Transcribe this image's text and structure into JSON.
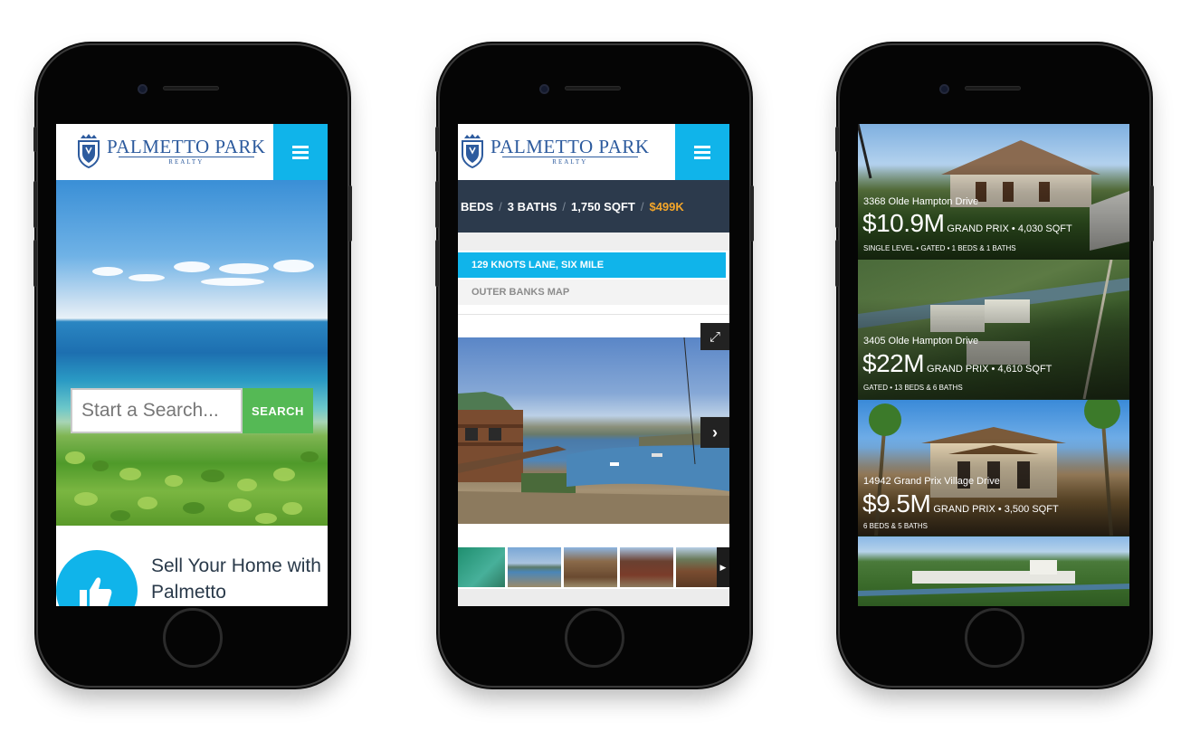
{
  "brand": {
    "name": "PALMETTO PARK",
    "sub": "REALTY"
  },
  "phone1": {
    "search": {
      "placeholder": "Start a Search...",
      "button": "SEARCH"
    },
    "sell": {
      "text": "Sell Your Home with Palmetto"
    }
  },
  "phone2": {
    "specs": {
      "beds": "BEDS",
      "baths": "3 BATHS",
      "sqft": "1,750 SQFT",
      "price": "$499K"
    },
    "tabs": {
      "address": "129 KNOTS LANE, SIX MILE",
      "map": "OUTER BANKS MAP"
    }
  },
  "phone3": {
    "listings": [
      {
        "address": "3368 Olde Hampton Drive",
        "price": "$10.9M",
        "details": "GRAND PRIX • 4,030 SQFT",
        "features": "SINGLE LEVEL • GATED • 1 BEDS & 1 BATHS"
      },
      {
        "address": "3405 Olde Hampton Drive",
        "price": "$22M",
        "details": "GRAND PRIX • 4,610 SQFT",
        "features": "GATED • 13 BEDS & 6 BATHS"
      },
      {
        "address": "14942 Grand Prix Village Drive",
        "price": "$9.5M",
        "details": "GRAND PRIX • 3,500 SQFT",
        "features": "6 BEDS & 5 BATHS"
      }
    ]
  },
  "icons": {
    "menu": "hamburger-menu-icon",
    "crest": "crest-logo-icon",
    "thumbs_up": "thumbs-up-icon",
    "expand": "expand-icon",
    "next": "chevron-right-icon",
    "play": "play-icon"
  },
  "colors": {
    "accent": "#10b4ea",
    "brand_blue": "#2d5b9e",
    "search_green": "#55b955",
    "dark_bar": "#2c3a4c",
    "price_orange": "#f4a62a"
  }
}
